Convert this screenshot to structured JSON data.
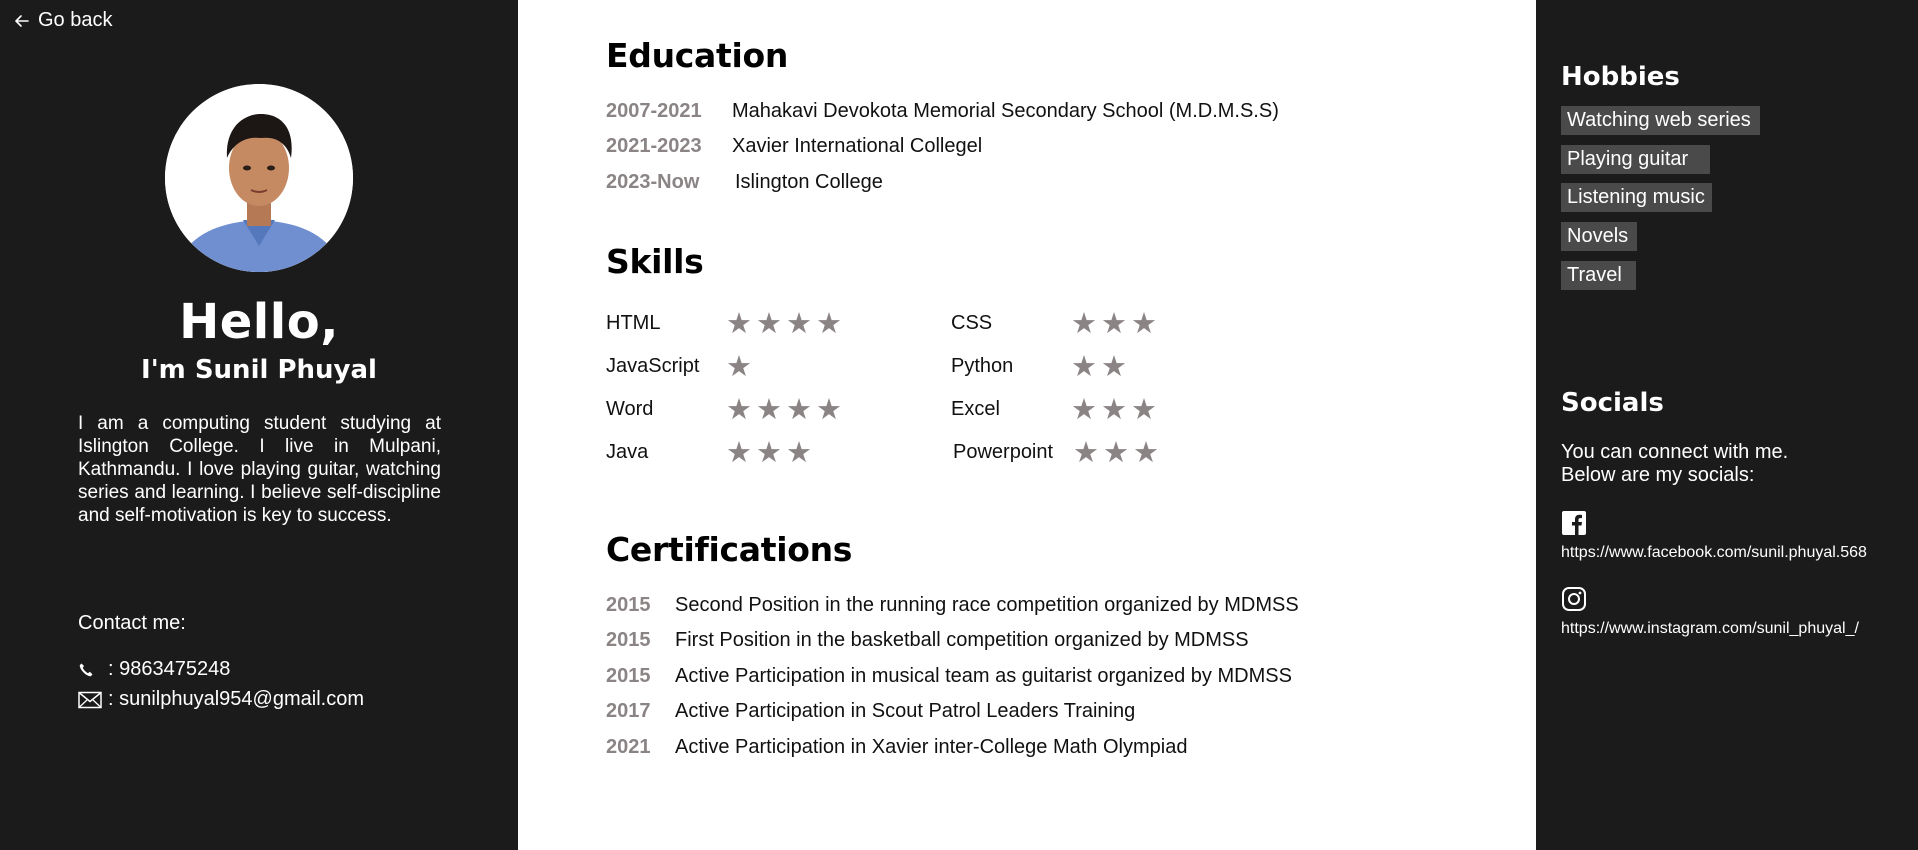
{
  "nav": {
    "back_label": "Go back"
  },
  "profile": {
    "greeting": "Hello,",
    "name": "I'm Sunil Phuyal",
    "bio": "I am a computing student studying at Islington College. I live in Mulpani, Kathmandu. I love playing guitar, watching series and learning. I believe self-discipline and self-motivation is key to success.",
    "contact_title": "Contact me:",
    "phone": ": 9863475248",
    "email": ": sunilphuyal954@gmail.com"
  },
  "education": {
    "title": "Education",
    "items": [
      {
        "years": "2007-2021",
        "school": "Mahakavi Devokota Memorial Secondary School (M.D.M.S.S)"
      },
      {
        "years": "2021-2023",
        "school": "Xavier International Collegel"
      },
      {
        "years": "2023-Now",
        "school": "Islington College"
      }
    ]
  },
  "skills": {
    "title": "Skills",
    "items": [
      {
        "name": "HTML",
        "stars": 4
      },
      {
        "name": "CSS",
        "stars": 3
      },
      {
        "name": "JavaScript",
        "stars": 1
      },
      {
        "name": "Python",
        "stars": 2
      },
      {
        "name": "Word",
        "stars": 4
      },
      {
        "name": "Excel",
        "stars": 3
      },
      {
        "name": "Java",
        "stars": 3
      },
      {
        "name": "Powerpoint",
        "stars": 3
      }
    ]
  },
  "certifications": {
    "title": "Certifications",
    "items": [
      {
        "year": "2015",
        "text": "Second Position in the running race competition organized by MDMSS"
      },
      {
        "year": "2015",
        "text": "First Position in the basketball competition organized by MDMSS"
      },
      {
        "year": "2015",
        "text": "Active Participation in musical team as guitarist organized by MDMSS"
      },
      {
        "year": "2017",
        "text": "Active Participation in Scout Patrol Leaders Training"
      },
      {
        "year": "2021",
        "text": "Active Participation in Xavier inter-College Math Olympiad"
      }
    ]
  },
  "hobbies": {
    "title": "Hobbies",
    "items": [
      "Watching web series",
      "Playing guitar",
      "Listening music",
      "Novels",
      "Travel"
    ]
  },
  "socials": {
    "title": "Socials",
    "text_line1": "You can connect with me.",
    "text_line2": "Below are my socials:",
    "facebook": "https://www.facebook.com/sunil.phuyal.568",
    "instagram": "https://www.instagram.com/sunil_phuyal_/"
  },
  "icons": {
    "back": "arrow-left-icon",
    "phone": "phone-icon",
    "email": "envelope-icon",
    "facebook": "facebook-icon",
    "instagram": "instagram-icon",
    "star": "star-icon"
  },
  "colors": {
    "panel_dark": "#1b1b1b",
    "accent_gray": "#8b8485",
    "hobby_tag": "#4a4a4a"
  }
}
